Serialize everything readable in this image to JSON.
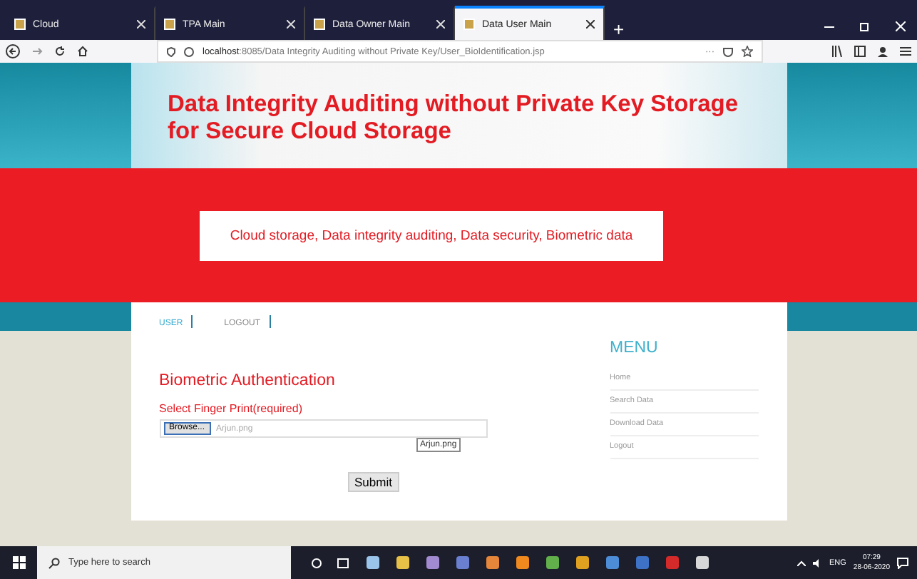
{
  "browser": {
    "tabs": [
      {
        "label": "Cloud",
        "selected": false
      },
      {
        "label": "TPA Main",
        "selected": false
      },
      {
        "label": "Data Owner Main",
        "selected": false
      },
      {
        "label": "Data User Main",
        "selected": true
      }
    ],
    "new_tab": "+",
    "url_host": "localhost",
    "url_rest": ":8085/Data Integrity Auditing without Private Key/User_BioIdentification.jsp",
    "more": "···"
  },
  "header": {
    "title_lines": [
      "Data Integrity Auditing without Private Key Storage",
      "for Secure Cloud Storage"
    ],
    "keywords": "Cloud storage, Data integrity auditing, Data security, Biometric data"
  },
  "nav": [
    {
      "label": "USER",
      "selected": true
    },
    {
      "label": "LOGOUT",
      "selected": false
    }
  ],
  "form": {
    "heading": "Biometric Authentication",
    "label": "Select Finger Print(required)",
    "browse": "Browse...",
    "file_name": "Arjun.png",
    "tooltip": "Arjun.png",
    "submit": "Submit"
  },
  "menu": {
    "title": "MENU",
    "items": [
      "Home",
      "Search Data",
      "Download Data",
      "Logout"
    ]
  },
  "taskbar": {
    "search_placeholder": "Type here to search",
    "lang": "ENG",
    "time": "07:29",
    "date": "28-06-2020"
  }
}
